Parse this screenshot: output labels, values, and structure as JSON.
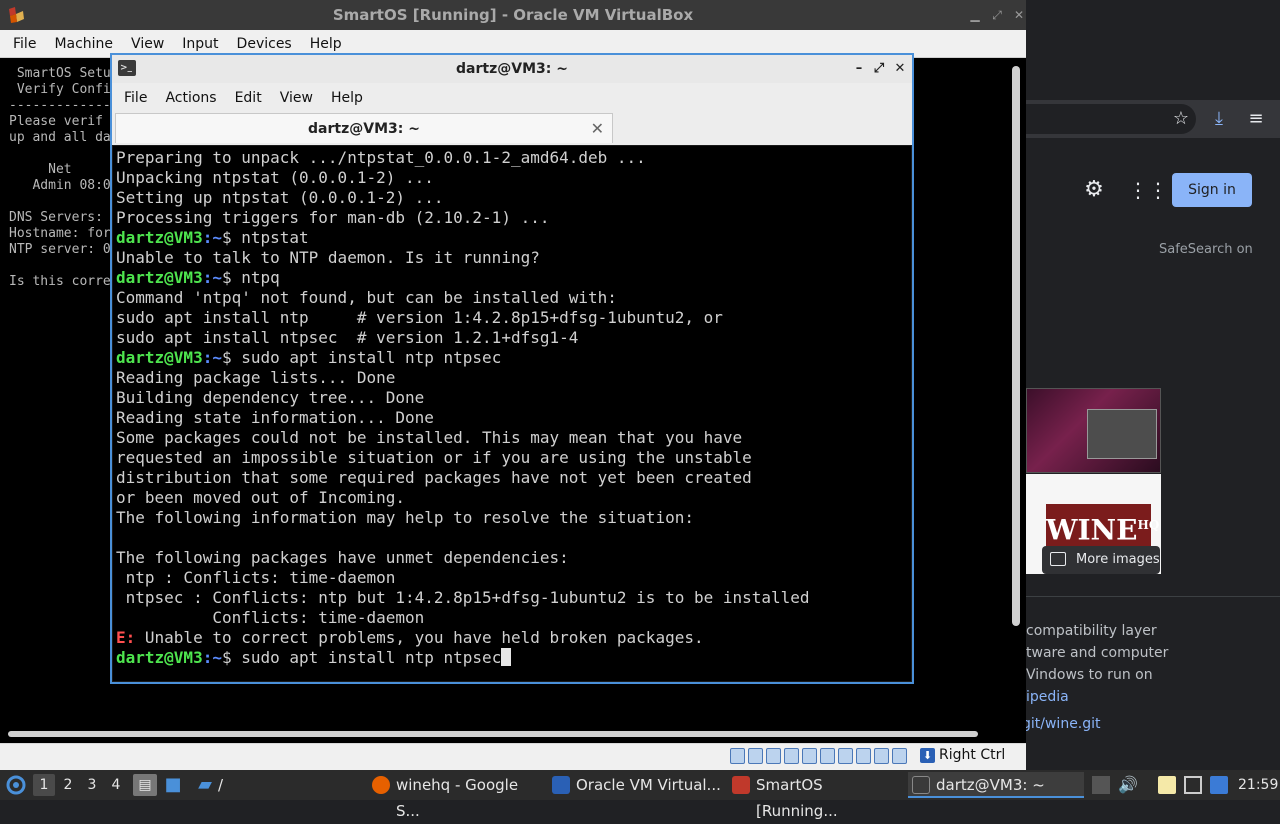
{
  "vbox": {
    "title": "SmartOS [Running] - Oracle VM VirtualBox",
    "menu": [
      "File",
      "Machine",
      "View",
      "Input",
      "Devices",
      "Help"
    ],
    "host_key": "Right Ctrl"
  },
  "guest_console": {
    "lines": [
      " SmartOS Setu",
      " Verify Confi",
      "-------------",
      "Please verif",
      "up and all da",
      "",
      "     Net",
      "   Admin 08:0",
      "",
      "DNS Servers:",
      "Hostname: for",
      "NTP server: 0",
      "",
      "Is this corre"
    ]
  },
  "terminal": {
    "title": "dartz@VM3: ~",
    "menu": [
      "File",
      "Actions",
      "Edit",
      "View",
      "Help"
    ],
    "tab_label": "dartz@VM3: ~",
    "prompt_user": "dartz@VM3",
    "prompt_path": ":~$ ",
    "error_prefix": "E:",
    "lines": [
      {
        "type": "out",
        "text": "Preparing to unpack .../ntpstat_0.0.0.1-2_amd64.deb ..."
      },
      {
        "type": "out",
        "text": "Unpacking ntpstat (0.0.0.1-2) ..."
      },
      {
        "type": "out",
        "text": "Setting up ntpstat (0.0.0.1-2) ..."
      },
      {
        "type": "out",
        "text": "Processing triggers for man-db (2.10.2-1) ..."
      },
      {
        "type": "cmd",
        "text": "ntpstat"
      },
      {
        "type": "out",
        "text": "Unable to talk to NTP daemon. Is it running?"
      },
      {
        "type": "cmd",
        "text": "ntpq"
      },
      {
        "type": "out",
        "text": "Command 'ntpq' not found, but can be installed with:"
      },
      {
        "type": "out",
        "text": "sudo apt install ntp     # version 1:4.2.8p15+dfsg-1ubuntu2, or"
      },
      {
        "type": "out",
        "text": "sudo apt install ntpsec  # version 1.2.1+dfsg1-4"
      },
      {
        "type": "cmd",
        "text": "sudo apt install ntp ntpsec"
      },
      {
        "type": "out",
        "text": "Reading package lists... Done"
      },
      {
        "type": "out",
        "text": "Building dependency tree... Done"
      },
      {
        "type": "out",
        "text": "Reading state information... Done"
      },
      {
        "type": "out",
        "text": "Some packages could not be installed. This may mean that you have"
      },
      {
        "type": "out",
        "text": "requested an impossible situation or if you are using the unstable"
      },
      {
        "type": "out",
        "text": "distribution that some required packages have not yet been created"
      },
      {
        "type": "out",
        "text": "or been moved out of Incoming."
      },
      {
        "type": "out",
        "text": "The following information may help to resolve the situation:"
      },
      {
        "type": "out",
        "text": ""
      },
      {
        "type": "out",
        "text": "The following packages have unmet dependencies:"
      },
      {
        "type": "out",
        "text": " ntp : Conflicts: time-daemon"
      },
      {
        "type": "out",
        "text": " ntpsec : Conflicts: ntp but 1:4.2.8p15+dfsg-1ubuntu2 is to be installed"
      },
      {
        "type": "out",
        "text": "          Conflicts: time-daemon"
      },
      {
        "type": "err",
        "text": " Unable to correct problems, you have held broken packages."
      },
      {
        "type": "input",
        "text": "sudo apt install ntp ntpsec"
      }
    ]
  },
  "browser": {
    "sign_in": "Sign in",
    "safesearch": "SafeSearch on",
    "thumb_logo_text": "WINE",
    "thumb_logo_sup": "HQ",
    "more_images": "More images",
    "snippet_lines": [
      "compatibility layer",
      "tware and computer",
      "Vindows to run on"
    ],
    "snippet_link": "ipedia",
    "git_url": "git/wine.git"
  },
  "taskbar": {
    "workspaces": [
      "1",
      "2",
      "3",
      "4"
    ],
    "folder_label": "/",
    "tasks": [
      {
        "label": "winehq - Google S...",
        "icon": "firefox-icon",
        "color": "#e66000"
      },
      {
        "label": "Oracle VM Virtual...",
        "icon": "virtualbox-icon",
        "color": "#2a60b5"
      },
      {
        "label": "SmartOS [Running...",
        "icon": "vm-icon",
        "color": "#c0392b"
      },
      {
        "label": "dartz@VM3: ~",
        "icon": "terminal-icon",
        "color": "#3a3a3a"
      }
    ],
    "clock": "21:59"
  }
}
